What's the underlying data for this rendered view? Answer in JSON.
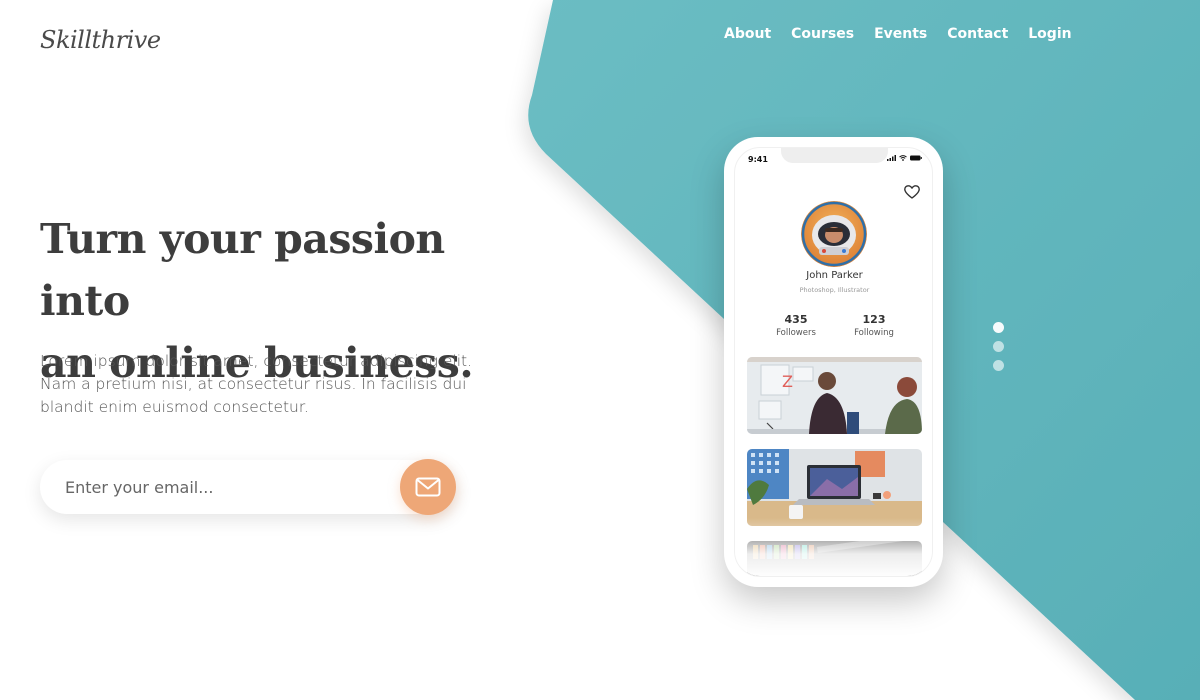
{
  "brand": {
    "logo_text": "Skillthrive"
  },
  "nav": {
    "items": [
      {
        "label": "About"
      },
      {
        "label": "Courses"
      },
      {
        "label": "Events"
      },
      {
        "label": "Contact"
      },
      {
        "label": "Login"
      }
    ]
  },
  "hero": {
    "title_line1": "Turn your passion into",
    "title_line2": "an online business.",
    "description": "Lorem ipsum dolor sit amet, consectetur adipiscing elit. Nam a pretium nisi, at consectetur risus. In facilisis dui blandit enim euismod consectetur."
  },
  "signup": {
    "email_placeholder": "Enter your email...",
    "submit_icon": "envelope-icon"
  },
  "phone": {
    "status_time": "9:41",
    "profile": {
      "name": "John Parker",
      "role": "Photoshop, Illustrator",
      "followers_count": "435",
      "followers_label": "Followers",
      "following_count": "123",
      "following_label": "Following"
    }
  },
  "slider": {
    "dot_count": 3,
    "active_index": 0
  },
  "colors": {
    "teal": "#62b8bf",
    "accent_orange": "#eea777",
    "text_dark": "#3d3d3d"
  }
}
